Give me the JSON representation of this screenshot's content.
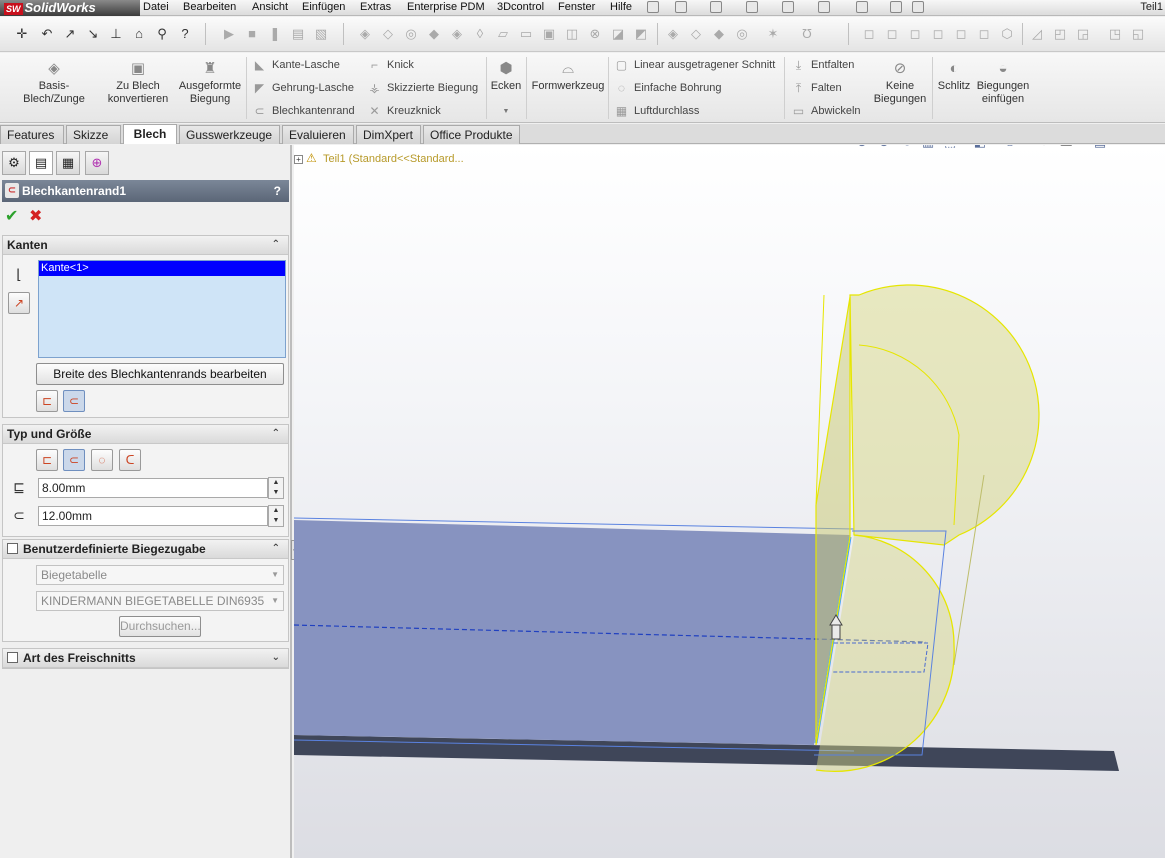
{
  "app": {
    "logo_badge": "SW",
    "logo_text": "SolidWorks",
    "document_title": "Teil1"
  },
  "menu": [
    "Datei",
    "Bearbeiten",
    "Ansicht",
    "Einfügen",
    "Extras",
    "Enterprise PDM",
    "3Dcontrol",
    "Fenster",
    "Hilfe"
  ],
  "command_manager": {
    "basis_blech": "Basis-Blech/Zunge",
    "zu_blech_line1": "Zu Blech",
    "zu_blech_line2": "konvertieren",
    "ausgeformte_line1": "Ausgeformte",
    "ausgeformte_line2": "Biegung",
    "kante_lasche": "Kante-Lasche",
    "gehrung_lasche": "Gehrung-Lasche",
    "blechkantenrand": "Blechkantenrand",
    "knick": "Knick",
    "skizzierte_biegung": "Skizzierte Biegung",
    "kreuzknick": "Kreuzknick",
    "ecken": "Ecken",
    "formwerkzeug": "Formwerkzeug",
    "linear_schnitt": "Linear ausgetragener Schnitt",
    "einfache_bohrung": "Einfache Bohrung",
    "luftdurchlass": "Luftdurchlass",
    "entfalten": "Entfalten",
    "falten": "Falten",
    "abwickeln": "Abwickeln",
    "keine_line1": "Keine",
    "keine_line2": "Biegungen",
    "schlitz": "Schlitz",
    "biegungen_line1": "Biegungen",
    "biegungen_line2": "einfügen"
  },
  "tabs": [
    "Features",
    "Skizze",
    "Blech",
    "Gusswerkzeuge",
    "Evaluieren",
    "DimXpert",
    "Office Produkte"
  ],
  "active_tab": "Blech",
  "property_manager": {
    "title": "Blechkantenrand1",
    "help": "?",
    "ok_symbol": "✔",
    "cancel_symbol": "✖",
    "kanten": {
      "heading": "Kanten",
      "selected_item": "Kante<1>",
      "edit_button": "Breite des Blechkantenrands bearbeiten"
    },
    "typ_groesse": {
      "heading": "Typ und Größe",
      "length_value": "8.00mm",
      "radius_value": "12.00mm"
    },
    "biegezugabe": {
      "heading": "Benutzerdefinierte Biegezugabe",
      "type_selected": "Biegetabelle",
      "table_selected": "KINDERMANN BIEGETABELLE DIN6935",
      "browse_button": "Durchsuchen..."
    },
    "freischnitt": {
      "heading": "Art des Freischnitts"
    }
  },
  "feature_tree": {
    "root_label": "Teil1  (Standard<<Standard..."
  },
  "colors": {
    "accent_header": "#5b6677",
    "selection_blue": "#0000ff",
    "preview_yellow": "#e8e86a",
    "part_face": "#8290bf"
  }
}
